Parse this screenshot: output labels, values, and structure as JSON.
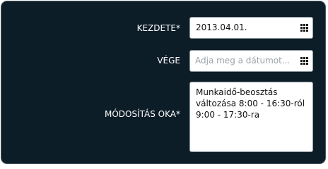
{
  "form": {
    "start": {
      "label": "KEZDETE*",
      "value": "2013.04.01.",
      "icon": "calendar-icon"
    },
    "end": {
      "label": "VÉGE",
      "value": "",
      "placeholder": "Adja meg a dátumot...",
      "icon": "calendar-icon"
    },
    "reason": {
      "label": "MÓDOSÍTÁS OKA*",
      "value": "Munkaidő-beosztás\nváltozása 8:00 - 16:30-ról\n9:00 - 17:30-ra"
    }
  },
  "colors": {
    "panel_background": "#0d1d28",
    "label_text": "#ffffff",
    "field_background": "#ffffff"
  }
}
